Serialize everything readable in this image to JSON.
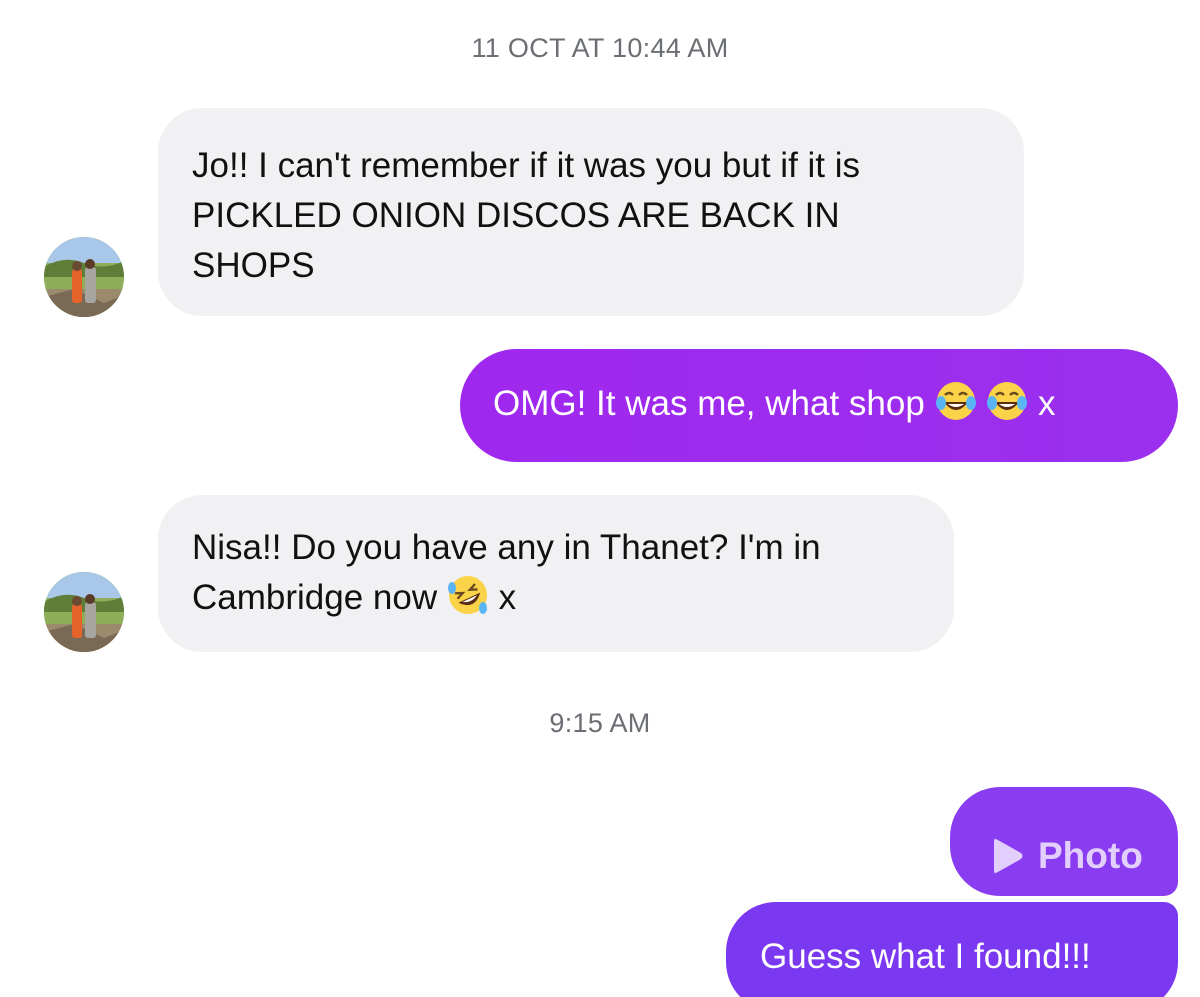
{
  "thread": {
    "timestamps": [
      "11 OCT AT 10:44 AM",
      "9:15 AM"
    ],
    "messages": [
      {
        "direction": "incoming",
        "lines": [
          "Jo!! I can't remember if it was you but if it is",
          "PICKLED ONION DISCOS ARE BACK IN",
          "SHOPS"
        ]
      },
      {
        "direction": "outgoing",
        "text": "OMG! It was me, what shop",
        "emojis": [
          "tears-of-joy",
          "tears-of-joy"
        ],
        "suffix": "x"
      },
      {
        "direction": "incoming",
        "lines": [
          "Nisa!! Do you have any in Thanet? I'm in",
          "Cambridge now"
        ],
        "emoji": "rolling-on-floor-laughing",
        "suffix": "x"
      },
      {
        "direction": "outgoing",
        "type": "attachment",
        "label": "Photo",
        "icon": "play-icon"
      },
      {
        "direction": "outgoing",
        "text": "Guess what I found!!!"
      }
    ]
  },
  "colors": {
    "incoming_bubble": "#f1f1f3",
    "outgoing_bubble": "#9a30ee",
    "outgoing_bubble_alt": "#7a38f0",
    "timestamp": "#6b6e73"
  }
}
